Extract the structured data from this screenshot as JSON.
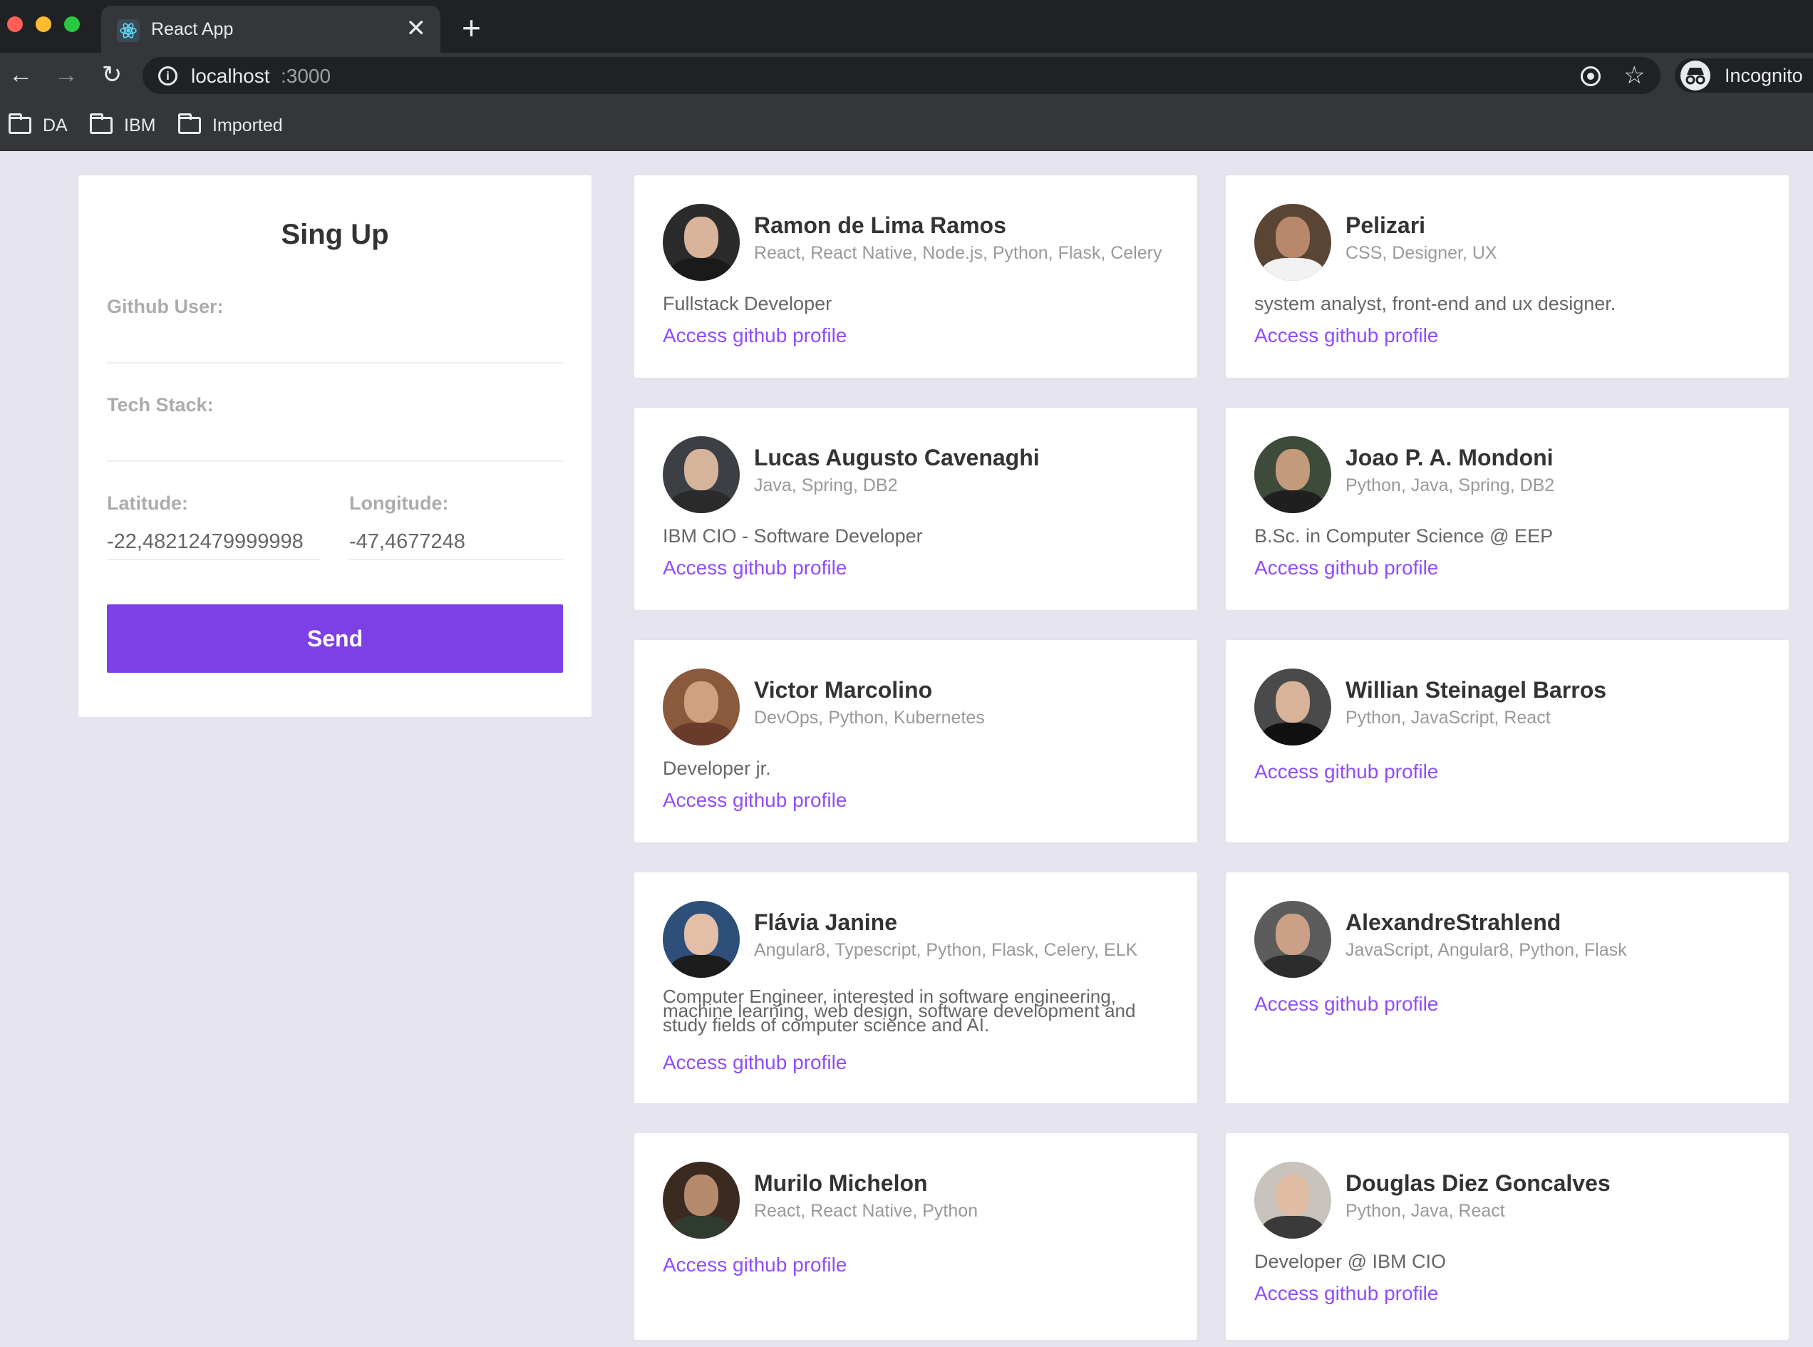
{
  "browser": {
    "tab_title": "React App",
    "url_host": "localhost",
    "url_port": ":3000",
    "profile_label": "Incognito",
    "bookmarks": [
      {
        "label": "DA"
      },
      {
        "label": "IBM"
      },
      {
        "label": "Imported"
      }
    ]
  },
  "colors": {
    "accent": "#7d40e7",
    "link": "#8e4dff",
    "page_background": "#e6e5ef"
  },
  "form": {
    "title": "Sing Up",
    "github_label": "Github User:",
    "github_value": "",
    "techs_label": "Tech Stack:",
    "techs_value": "",
    "latitude_label": "Latitude:",
    "latitude_value": "-22,48212479999998",
    "longitude_label": "Longitude:",
    "longitude_value": "-47,4677248",
    "submit_label": "Send"
  },
  "devs": [
    {
      "name": "Ramon de Lima Ramos",
      "techs": "React, React Native, Node.js, Python, Flask, Celery",
      "bio": "Fullstack Developer",
      "link": "Access github profile"
    },
    {
      "name": "Pelizari",
      "techs": "CSS, Designer, UX",
      "bio": "system analyst, front-end and ux designer.",
      "link": "Access github profile"
    },
    {
      "name": "Lucas Augusto Cavenaghi",
      "techs": "Java, Spring, DB2",
      "bio": "IBM CIO - Software Developer",
      "link": "Access github profile"
    },
    {
      "name": "Joao P. A. Mondoni",
      "techs": "Python, Java, Spring, DB2",
      "bio": "B.Sc. in Computer Science @ EEP",
      "link": "Access github profile"
    },
    {
      "name": "Victor Marcolino",
      "techs": "DevOps, Python, Kubernetes",
      "bio": "Developer jr.",
      "link": "Access github profile"
    },
    {
      "name": "Willian Steinagel Barros",
      "techs": "Python, JavaScript, React",
      "bio": "",
      "link": "Access github profile"
    },
    {
      "name": "Flávia Janine",
      "techs": "Angular8, Typescript, Python, Flask, Celery, ELK",
      "bio": "Computer Engineer, interested in software engineering, machine learning, web design, software development and study fields of computer science and AI.",
      "link": "Access github profile"
    },
    {
      "name": "AlexandreStrahlend",
      "techs": "JavaScript, Angular8, Python, Flask",
      "bio": "",
      "link": "Access github profile"
    },
    {
      "name": "Murilo Michelon",
      "techs": "React, React Native, Python",
      "bio": "",
      "link": "Access github profile"
    },
    {
      "name": "Douglas Diez Goncalves",
      "techs": "Python, Java, React",
      "bio": "Developer @ IBM CIO",
      "link": "Access github profile"
    }
  ]
}
